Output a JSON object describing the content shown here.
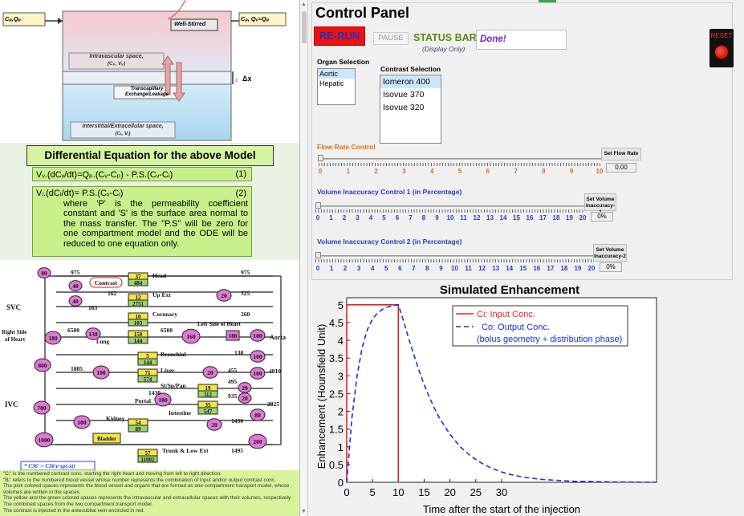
{
  "diagram": {
    "inflow_label": "Cₚ,Qₚ",
    "outflow_label": "Cₚ, Qᵥ=Qₚ",
    "well_stirred": "Well-Stirred",
    "intravascular": "Intravascular space,",
    "intravascular_sub": "(Cᵥ, Vᵥ)",
    "transcapillary": "Transcapillary",
    "transcapillary_sub": "Exchange/Leakage",
    "delta_x": "Δx",
    "interstitial": "Interstitial/Extracellular space,",
    "interstitial_sub": "(Cᵢ, Vᵢ)"
  },
  "equations": {
    "title": "Differential Equation for the above Model",
    "eq1": "Vᵥ.(dCᵥ/dt)=Qₚ.(Cᵥ-Cₚ) - P.S.(Cᵥ-Cᵢ)",
    "eq1_num": "(1)",
    "eq2": "Vᵢ.(dCᵢ/dt)= P.S.(Cᵥ-Cᵢ)",
    "eq2_num": "(2)",
    "eq2_body": "where 'P' is the permeability coefficient constant and 'S' is the surface area normal to the mass transfer. The \"P.S\" will be zero for one compartment model and the ODE will be reduced to one equation only."
  },
  "blood_network": {
    "labels": {
      "svc": "SVC",
      "ivc": "IVC",
      "rhs": "Right Side of Heart",
      "lhs": "Left Side of Heart",
      "aorta": "Aorta",
      "head": "Head",
      "upext": "Up Ext",
      "coronary": "Coronary",
      "lung": "Lung",
      "bronchial": "Bronchial",
      "liver": "Liver",
      "stspan": "St/Sp/Pan",
      "portal": "Portal",
      "intestine": "Intestine",
      "kidney": "Kidney",
      "bladder": "Bladder",
      "trunk": "Trunk & Low Ext",
      "contrast": "Contrast",
      "formula": "* C36' = C36·e·xp(-λt)"
    },
    "numbers": {
      "n975a": "975",
      "n975b": "975",
      "n162": "162",
      "n163": "163",
      "n325": "325",
      "n260": "260",
      "n6500a": "6500",
      "n6500b": "6500",
      "n130": "130",
      "n1885": "1885",
      "n455": "455",
      "n4810": "4810",
      "n495": "495",
      "n1430a": "1430",
      "n935": "935",
      "n2925": "2925",
      "n1430b": "1430",
      "n1495": "1495",
      "b37": "37",
      "b484": "484",
      "b12": "12",
      "b2751": "2751",
      "b10": "10",
      "b103": "103",
      "b150": "150",
      "b144": "144",
      "b5": "5",
      "b144b": "144",
      "b71": "71",
      "b574": "574",
      "b19": "19",
      "b112": "112",
      "b35": "35",
      "b547": "547",
      "b54": "54",
      "b89": "89",
      "b57": "57",
      "b11002": "11002",
      "c80": "80",
      "c40": "40",
      "c40b": "40",
      "c180": "180",
      "c130": "130",
      "c800": "800",
      "c100": "100",
      "c700": "700",
      "c1000": "1000",
      "c100b": "100",
      "c20": "20",
      "c20b": "20",
      "c160": "160",
      "c180b": "180",
      "c100c": "100",
      "c100d": "100",
      "c100e": "100",
      "c20c": "20",
      "c20d": "20",
      "c20e": "20",
      "c100f": "100",
      "c80b": "80",
      "c20f": "20",
      "c200": "200"
    }
  },
  "notes": [
    "\"Cᵢ\" is the numbered contrast conc. starting the right heart and moving from left to right direction.",
    "\"Bᵢ\" refers to the numbered blood vessel whose number represents the combination of input and/or output contrast conc.",
    "The pink colored spaces represents the blood vessel and organs that are formed as one compartment transport model, whose volumes are written in the spaces.",
    "The yellow and the green colored spaces represents the intravascular and extracellular spaces with their volumes, respectively. The combined spaces from the two compartment transport model.",
    "The contrast is injected in the antecubital vein encircled in red."
  ],
  "control_panel": {
    "title": "Control Panel",
    "rerun": "RE-RUN",
    "pause": "PAUSE",
    "status_label": "STATUS BAR",
    "status_sub": "(Display Only)",
    "status_value": "Done!",
    "reset": "RESET",
    "organ_label": "Organ Selection",
    "organs": [
      "Aortic",
      "Hepatic"
    ],
    "contrast_label": "Contrast Selection",
    "contrasts": [
      "Iomeron 400",
      "Isovue 370",
      "Isovue 320"
    ],
    "flow_label": "Flow Rate Control",
    "flow_ticks": [
      "0",
      "1",
      "2",
      "3",
      "4",
      "5",
      "6",
      "7",
      "8",
      "9",
      "10"
    ],
    "flow_button": "Set Flow Rate",
    "flow_value": "0.00",
    "flow_level": 0,
    "vol1_label": "Volume Inaccuracy Control 1 (in Percentage)",
    "vol_ticks": [
      "0",
      "1",
      "2",
      "3",
      "4",
      "5",
      "6",
      "7",
      "8",
      "9",
      "10",
      "11",
      "12",
      "13",
      "14",
      "15",
      "16",
      "17",
      "18",
      "19",
      "20"
    ],
    "vol1_button": "Set Volume Inaccuracy-1",
    "vol1_value": "0%",
    "vol1_level": 0,
    "vol2_label": "Volume Inaccuracy Control 2 (in Percentage)",
    "vol2_button": "Set Volume Inaccuracy-2",
    "vol2_value": "0%",
    "vol2_level": 0
  },
  "chart_data": {
    "type": "line",
    "title": "Simulated Enhancement",
    "xlabel": "Time after the start of the injection",
    "ylabel": "Enhancement (Hounsfield Unit)",
    "xlim": [
      0,
      60
    ],
    "ylim": [
      0,
      5.2
    ],
    "xticks": [
      0,
      5,
      10,
      15,
      20,
      25,
      30
    ],
    "yticks": [
      0,
      0.5,
      1,
      1.5,
      2,
      2.5,
      3,
      3.5,
      4,
      4.5,
      5
    ],
    "legend_position": "top-right",
    "series": [
      {
        "name": "Ci: Input Conc.",
        "color": "#e52222",
        "style": "solid",
        "x": [
          0,
          0,
          10,
          10
        ],
        "y": [
          0,
          5,
          5,
          0
        ]
      },
      {
        "name": "Co: Output Conc.",
        "color": "#1a2fe0",
        "style": "dashed",
        "x": [
          0,
          1,
          2,
          3,
          4,
          5,
          6,
          7,
          8,
          9,
          10,
          11,
          12,
          13,
          14,
          15,
          16,
          17,
          18,
          20,
          22,
          24,
          26,
          28,
          30,
          32,
          34,
          36,
          38,
          40,
          44,
          48,
          52,
          56,
          60
        ],
        "y": [
          0,
          1.8,
          3.0,
          3.8,
          4.3,
          4.6,
          4.78,
          4.88,
          4.94,
          4.98,
          5.0,
          4.55,
          4.05,
          3.6,
          3.15,
          2.75,
          2.4,
          2.08,
          1.8,
          1.35,
          1.0,
          0.74,
          0.55,
          0.4,
          0.29,
          0.21,
          0.15,
          0.11,
          0.08,
          0.06,
          0.03,
          0.02,
          0.01,
          0.005,
          0
        ]
      }
    ],
    "legend_extra": "(bolus geometry + distribution phase)"
  }
}
